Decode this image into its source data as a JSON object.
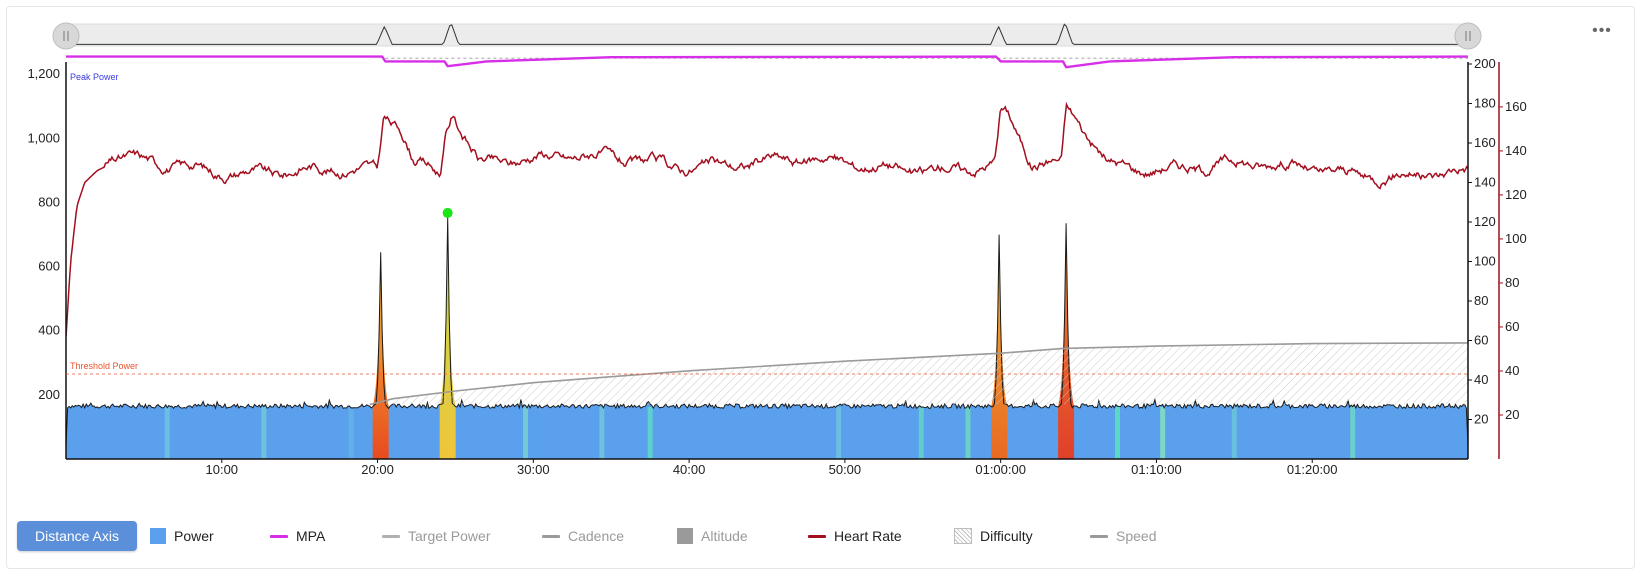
{
  "colors": {
    "power": "#5aa0ec",
    "mpa": "#d72ee8",
    "heart_rate": "#a30f1f",
    "difficulty": "#9a9a9a",
    "threshold": "#e8542f",
    "peak_marker": "#19e619",
    "peak_power_label": "#3a3ae0",
    "navigator_bg": "#ececec"
  },
  "toolbar": {
    "menu_label": "•••",
    "axis_button": "Distance Axis"
  },
  "legend": [
    {
      "label": "Power",
      "icon": "square-swatch",
      "color": "#5aa0ec",
      "enabled": true
    },
    {
      "label": "MPA",
      "icon": "line-swatch",
      "color": "#d72ee8",
      "enabled": true
    },
    {
      "label": "Target Power",
      "icon": "line-swatch",
      "color": "#b0b0b0",
      "enabled": false
    },
    {
      "label": "Cadence",
      "icon": "line-swatch",
      "color": "#9a9a9a",
      "enabled": false
    },
    {
      "label": "Altitude",
      "icon": "square-swatch",
      "color": "#9a9a9a",
      "enabled": false
    },
    {
      "label": "Heart Rate",
      "icon": "line-swatch",
      "color": "#a30f1f",
      "enabled": true
    },
    {
      "label": "Difficulty",
      "icon": "hatch-swatch",
      "color": "#bdbdbd",
      "enabled": true
    },
    {
      "label": "Speed",
      "icon": "line-swatch",
      "color": "#9a9a9a",
      "enabled": false
    }
  ],
  "annotations": {
    "peak_power": "Peak Power",
    "threshold_power": "Threshold Power"
  },
  "chart_data": {
    "type": "area",
    "x_unit": "elapsed time",
    "x_range_minutes": [
      0,
      90
    ],
    "x_ticks": [
      {
        "minutes": 10,
        "label": "10:00"
      },
      {
        "minutes": 20,
        "label": "20:00"
      },
      {
        "minutes": 30,
        "label": "30:00"
      },
      {
        "minutes": 40,
        "label": "40:00"
      },
      {
        "minutes": 50,
        "label": "50:00"
      },
      {
        "minutes": 60,
        "label": "01:00:00"
      },
      {
        "minutes": 70,
        "label": "01:10:00"
      },
      {
        "minutes": 80,
        "label": "01:20:00"
      }
    ],
    "y_axes": {
      "power": {
        "range": [
          0,
          1260
        ],
        "ticks": [
          200,
          400,
          600,
          800,
          1000,
          1200
        ],
        "tick_labels": [
          "200",
          "400",
          "600",
          "800",
          "1,000",
          "1,200"
        ]
      },
      "mpa_scale": {
        "range": [
          0,
          200
        ],
        "ticks": [
          20,
          40,
          60,
          80,
          100,
          120,
          140,
          160,
          180,
          200
        ]
      },
      "heart_rate": {
        "range": [
          0,
          200
        ],
        "ticks": [
          20,
          40,
          60,
          80,
          100,
          120,
          140,
          160
        ],
        "color": "#a30f1f"
      }
    },
    "threshold_power": 265,
    "series": [
      {
        "name": "Power",
        "kind": "area",
        "baseline_watts": 165,
        "efforts": [
          {
            "minutes": 20.2,
            "watts": 645
          },
          {
            "minutes": 24.5,
            "watts": 755
          },
          {
            "minutes": 59.9,
            "watts": 700
          },
          {
            "minutes": 64.2,
            "watts": 735
          }
        ],
        "peak": {
          "minutes": 24.5,
          "watts": 755
        }
      },
      {
        "name": "MPA",
        "kind": "line",
        "points": [
          [
            0,
            1255
          ],
          [
            20.3,
            1255
          ],
          [
            20.5,
            1240
          ],
          [
            24.3,
            1240
          ],
          [
            24.5,
            1225
          ],
          [
            27,
            1240
          ],
          [
            35,
            1253
          ],
          [
            59.7,
            1255
          ],
          [
            60.0,
            1240
          ],
          [
            64.0,
            1240
          ],
          [
            64.2,
            1222
          ],
          [
            67,
            1240
          ],
          [
            75,
            1253
          ],
          [
            90,
            1255
          ]
        ]
      },
      {
        "name": "Heart Rate",
        "kind": "line",
        "baseline_bpm": 143,
        "points": [
          [
            0,
            62
          ],
          [
            0.3,
            100
          ],
          [
            0.7,
            128
          ],
          [
            1.2,
            140
          ],
          [
            2,
            146
          ],
          [
            3,
            150
          ],
          [
            20.0,
            144
          ],
          [
            20.4,
            172
          ],
          [
            21.5,
            168
          ],
          [
            22.3,
            152
          ],
          [
            24.0,
            146
          ],
          [
            24.4,
            168
          ],
          [
            24.8,
            178
          ],
          [
            26.5,
            152
          ],
          [
            59.6,
            148
          ],
          [
            60.0,
            175
          ],
          [
            60.5,
            172
          ],
          [
            62,
            148
          ],
          [
            63.9,
            148
          ],
          [
            64.2,
            176
          ],
          [
            64.8,
            172
          ],
          [
            67,
            150
          ],
          [
            90,
            144
          ]
        ]
      },
      {
        "name": "Difficulty",
        "kind": "hatched-area",
        "points": [
          [
            19.5,
            170
          ],
          [
            21,
            188
          ],
          [
            25,
            212
          ],
          [
            30,
            238
          ],
          [
            40,
            275
          ],
          [
            50,
            305
          ],
          [
            60,
            330
          ],
          [
            64,
            345
          ],
          [
            70,
            352
          ],
          [
            80,
            360
          ],
          [
            90,
            362
          ]
        ]
      }
    ],
    "navigator": {
      "spikes_minutes": [
        20.2,
        24.5,
        59.9,
        64.2
      ]
    }
  }
}
